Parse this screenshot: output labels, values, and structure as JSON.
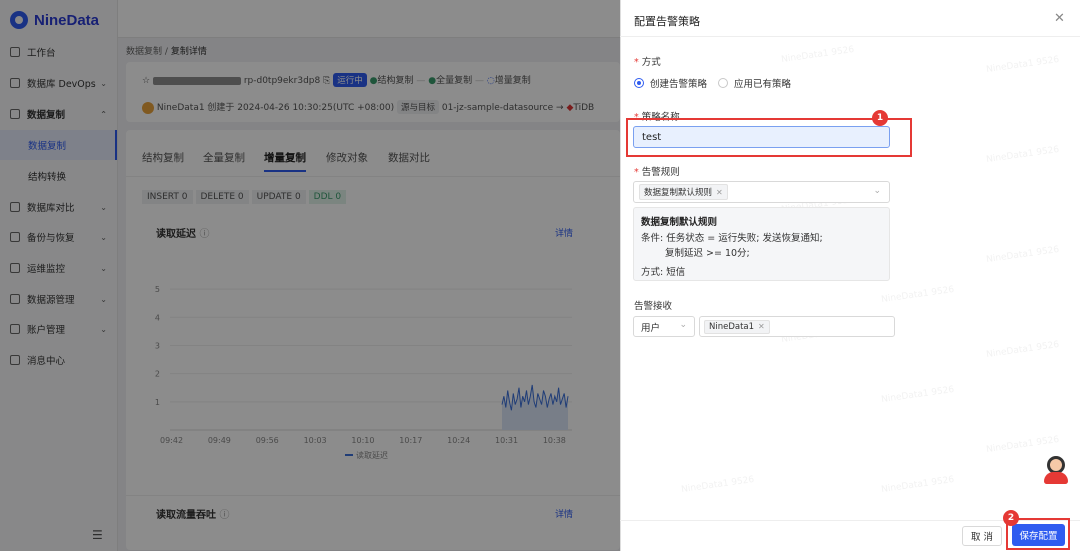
{
  "app": {
    "logo_text": "NineData"
  },
  "sidebar": {
    "items": [
      {
        "label": "工作台",
        "icon": "home-icon"
      },
      {
        "label": "数据库 DevOps",
        "icon": "database-icon"
      },
      {
        "label": "数据复制",
        "icon": "replication-icon"
      },
      {
        "label": "数据复制"
      },
      {
        "label": "结构转换"
      },
      {
        "label": "数据库对比",
        "icon": "compare-icon"
      },
      {
        "label": "备份与恢复",
        "icon": "backup-icon"
      },
      {
        "label": "运维监控",
        "icon": "monitor-icon"
      },
      {
        "label": "数据源管理",
        "icon": "datasource-icon"
      },
      {
        "label": "账户管理",
        "icon": "account-icon"
      },
      {
        "label": "消息中心",
        "icon": "message-icon"
      }
    ]
  },
  "main": {
    "breadcrumb": {
      "parent": "数据复制",
      "sep": "/",
      "current": "复制详情"
    },
    "task_id": "rp-d0tp9ekr3dp8",
    "status": "运行中",
    "steps": [
      "结构复制",
      "全量复制",
      "增量复制"
    ],
    "creator_line": "NineData1 创建于 2024-04-26 10:30:25(UTC +08:00)",
    "source_target_label": "源与目标",
    "source_target_value": "01-jz-sample-datasource",
    "target_name": "TiDB",
    "tabs": [
      "结构复制",
      "全量复制",
      "增量复制",
      "修改对象",
      "数据对比"
    ],
    "active_tab": "增量复制",
    "stats": [
      {
        "label": "INSERT",
        "value": "0"
      },
      {
        "label": "DELETE",
        "value": "0"
      },
      {
        "label": "UPDATE",
        "value": "0"
      },
      {
        "label": "DDL",
        "value": "0"
      }
    ],
    "latency_card": {
      "title": "读取延迟",
      "detail": "详情"
    },
    "throughput_card": {
      "title": "读取流量吞吐",
      "detail": "详情"
    }
  },
  "chart_data": {
    "type": "line",
    "x": [
      "09:42",
      "09:49",
      "09:56",
      "10:03",
      "10:10",
      "10:17",
      "10:24",
      "10:31",
      "10:38"
    ],
    "y_ticks": [
      "1",
      "2",
      "3",
      "4",
      "5"
    ],
    "ylim": [
      0,
      5.5
    ],
    "series": [
      {
        "name": "读取延迟",
        "color": "#3b6fd9",
        "values_tail": [
          0.9,
          1.2,
          0.8,
          1.4,
          1.0,
          0.7,
          1.3,
          0.9,
          1.1,
          1.5,
          0.8,
          1.2,
          1.0,
          1.4,
          0.9,
          1.2,
          1.6,
          1.0,
          0.8,
          1.3,
          1.1,
          0.9,
          1.4,
          1.2,
          0.8,
          1.1,
          1.3,
          0.9,
          1.2,
          1.0,
          1.5,
          0.9,
          1.1,
          1.3,
          0.8,
          1.2
        ]
      }
    ]
  },
  "drawer": {
    "title": "配置告警策略",
    "method_label": "方式",
    "method_options": [
      "创建告警策略",
      "应用已有策略"
    ],
    "name_label": "策略名称",
    "name_value": "test",
    "rules_label": "告警规则",
    "rules_chip": "数据复制默认规则",
    "rule_box": {
      "title": "数据复制默认规则",
      "line1": "条件: 任务状态 = 运行失败; 发送恢复通知;",
      "line2": "复制延迟 >= 10分;",
      "line3": "方式: 短信"
    },
    "receiver_label": "告警接收",
    "receiver_type": "用户",
    "receiver_chip": "NineData1",
    "cancel_label": "取 消",
    "save_label": "保存配置",
    "badge1": "1",
    "badge2": "2",
    "watermark": "NineData1 9526"
  }
}
